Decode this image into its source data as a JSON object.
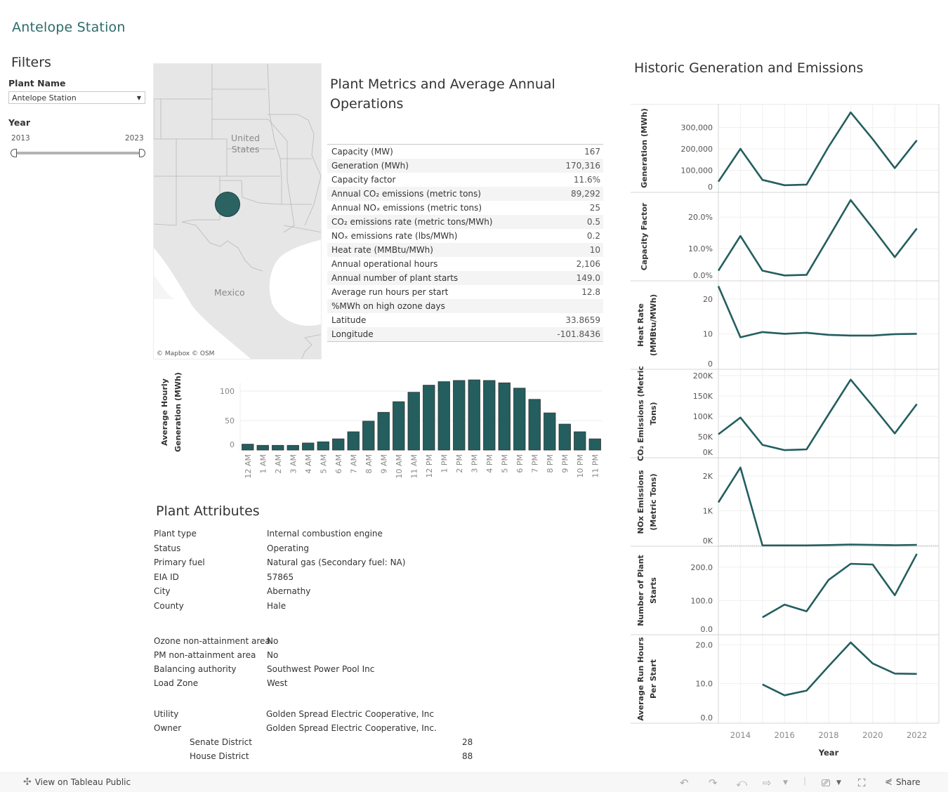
{
  "app": {
    "title": "Antelope Station"
  },
  "filters": {
    "title": "Filters",
    "plant_name_label": "Plant Name",
    "plant_name_value": "Antelope Station",
    "year_label": "Year",
    "year_min": "2013",
    "year_max": "2023"
  },
  "map": {
    "labels": {
      "us_line1": "United",
      "us_line2": "States",
      "mexico": "Mexico"
    },
    "credits": [
      "© Mapbox",
      "© OSM"
    ],
    "marker_color": "#2b6363"
  },
  "metrics": {
    "title": "Plant Metrics and Average Annual Operations",
    "rows": [
      {
        "label": "Capacity (MW)",
        "value": "167"
      },
      {
        "label": "Generation (MWh)",
        "value": "170,316"
      },
      {
        "label": "Capacity factor",
        "value": "11.6%"
      },
      {
        "label": "Annual CO₂ emissions (metric tons)",
        "value": "89,292"
      },
      {
        "label": "Annual NOₓ emissions (metric tons)",
        "value": "25"
      },
      {
        "label": "CO₂ emissions rate (metric tons/MWh)",
        "value": "0.5"
      },
      {
        "label": "NOₓ emissions rate (lbs/MWh)",
        "value": "0.2"
      },
      {
        "label": "Heat rate (MMBtu/MWh)",
        "value": "10"
      },
      {
        "label": "Annual operational hours",
        "value": "2,106"
      },
      {
        "label": "Annual number of plant starts",
        "value": "149.0"
      },
      {
        "label": "Average run hours per start",
        "value": "12.8"
      },
      {
        "label": "%MWh on high ozone days",
        "value": ""
      },
      {
        "label": "Latitude",
        "value": "33.8659"
      },
      {
        "label": "Longitude",
        "value": "-101.8436"
      }
    ]
  },
  "attributes": {
    "title": "Plant Attributes",
    "group1": [
      {
        "label": "Plant type",
        "value": "Internal combustion engine"
      },
      {
        "label": "Status",
        "value": "Operating"
      },
      {
        "label": "Primary fuel",
        "value": "Natural gas (Secondary fuel: NA)"
      },
      {
        "label": "EIA ID",
        "value": "57865"
      },
      {
        "label": "City",
        "value": "Abernathy"
      },
      {
        "label": "County",
        "value": "Hale"
      }
    ],
    "group2": [
      {
        "label": "Ozone non-attainment area",
        "value": "No"
      },
      {
        "label": "PM non-attainment area",
        "value": "No"
      },
      {
        "label": "Balancing authority",
        "value": "Southwest Power Pool Inc"
      },
      {
        "label": "Load Zone",
        "value": "West"
      }
    ],
    "group3": [
      {
        "label": "Utility",
        "value": "Golden Spread Electric Cooperative, Inc"
      },
      {
        "label": "Owner",
        "value": "Golden Spread Electric Cooperative, Inc."
      }
    ],
    "districts": [
      {
        "label": "Senate District",
        "value": "28"
      },
      {
        "label": "House District",
        "value": "88"
      }
    ]
  },
  "historic": {
    "title": "Historic Generation and Emissions"
  },
  "toolbar": {
    "view_label": "View on Tableau Public",
    "share_label": "Share"
  },
  "chart_data": [
    {
      "type": "bar",
      "title": "",
      "ylabel": "Average Hourly Generation (MWh)",
      "xlabel": "",
      "ylim": [
        0,
        125
      ],
      "yticks": [
        0,
        50,
        100
      ],
      "categories": [
        "12 AM",
        "1 AM",
        "2 AM",
        "3 AM",
        "4 AM",
        "5 AM",
        "6 AM",
        "7 AM",
        "8 AM",
        "9 AM",
        "10 AM",
        "11 AM",
        "12 PM",
        "1 PM",
        "2 PM",
        "3 PM",
        "4 PM",
        "5 PM",
        "6 PM",
        "7 PM",
        "8 PM",
        "9 PM",
        "10 PM",
        "11 PM"
      ],
      "values": [
        10,
        8,
        8,
        8,
        12,
        14,
        19,
        31,
        49,
        64,
        82,
        98,
        110,
        116,
        118,
        119,
        118,
        114,
        105,
        86,
        63,
        44,
        31,
        19
      ],
      "color": "#245e5f"
    },
    {
      "type": "line",
      "title": "Historic Generation and Emissions",
      "xlabel": "Year",
      "xlim": [
        2013,
        2023
      ],
      "xticks": [
        2014,
        2016,
        2018,
        2020,
        2022
      ],
      "x": [
        2013,
        2014,
        2015,
        2016,
        2017,
        2018,
        2019,
        2020,
        2021,
        2022
      ],
      "color": "#245e5f",
      "panels": [
        {
          "name": "Generation (MWh)",
          "ylim": [
            0,
            390000
          ],
          "yticks": [
            0,
            100000,
            200000,
            300000
          ],
          "ytick_labels": [
            "0",
            "100,000",
            "200,000",
            "300,000"
          ],
          "values": [
            47000,
            200000,
            55000,
            30000,
            33000,
            210000,
            370000,
            245000,
            110000,
            240000
          ]
        },
        {
          "name": "Capacity Factor",
          "ylim": [
            0,
            0.265
          ],
          "yticks": [
            0,
            0.1,
            0.2
          ],
          "ytick_labels": [
            "0.0%",
            "10.0%",
            "20.0%"
          ],
          "values": [
            0.03,
            0.14,
            0.03,
            0.015,
            0.017,
            0.135,
            0.254,
            0.165,
            0.073,
            0.164
          ]
        },
        {
          "name": "Heat Rate (MMBtu/MWh)",
          "ylim": [
            0,
            24
          ],
          "yticks": [
            0,
            10,
            20
          ],
          "ytick_labels": [
            "0",
            "10",
            "20"
          ],
          "values": [
            23.7,
            9.0,
            10.5,
            10.0,
            10.3,
            9.7,
            9.5,
            9.5,
            9.9,
            10.0
          ]
        },
        {
          "name": "CO₂ Emissions (Metric Tons)",
          "ylim": [
            0,
            205000
          ],
          "yticks": [
            0,
            50000,
            100000,
            150000,
            200000
          ],
          "ytick_labels": [
            "0K",
            "50K",
            "100K",
            "150K",
            "200K"
          ],
          "values": [
            56000,
            97000,
            30000,
            17000,
            19000,
            105000,
            190000,
            125000,
            58000,
            130000
          ]
        },
        {
          "name": "NOx Emissions (Metric Tons)",
          "ylim": [
            0,
            2400
          ],
          "yticks": [
            0,
            1000,
            2000
          ],
          "ytick_labels": [
            "0K",
            "1K",
            "2K"
          ],
          "values": [
            1240,
            2240,
            5,
            5,
            5,
            15,
            30,
            20,
            10,
            20
          ]
        },
        {
          "name": "Number of Plant Starts",
          "ylim": [
            0,
            250
          ],
          "yticks": [
            0,
            100,
            200
          ],
          "ytick_labels": [
            "0.0",
            "100.0",
            "200.0"
          ],
          "values": [
            null,
            null,
            50,
            88,
            68,
            162,
            210,
            208,
            116,
            240
          ]
        },
        {
          "name": "Average Run Hours Per Start",
          "ylim": [
            0,
            21.5
          ],
          "yticks": [
            0,
            10,
            20
          ],
          "ytick_labels": [
            "0.0",
            "10.0",
            "20.0"
          ],
          "values": [
            null,
            null,
            9.8,
            7.0,
            8.2,
            14.5,
            20.6,
            15.2,
            12.6,
            12.5
          ]
        }
      ]
    }
  ]
}
